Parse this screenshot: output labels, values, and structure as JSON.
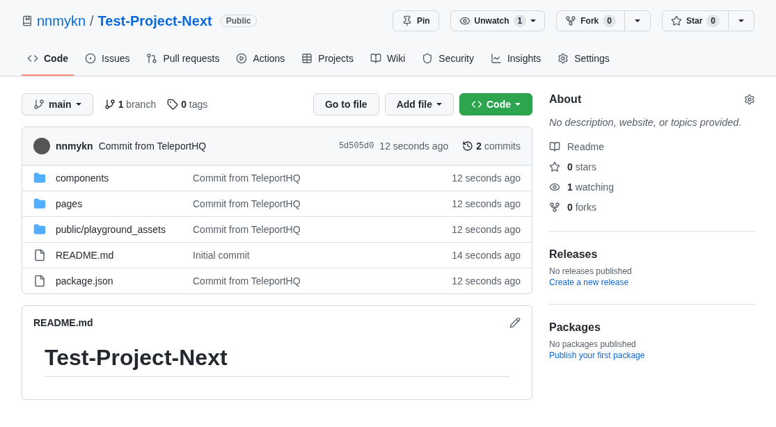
{
  "repo": {
    "owner": "nnmykn",
    "separator": "/",
    "name": "Test-Project-Next",
    "visibility": "Public"
  },
  "actions": [
    {
      "label": "Pin",
      "kind": "plain"
    },
    {
      "label": "Unwatch",
      "count": "1",
      "kind": "caret"
    },
    {
      "label": "Fork",
      "count": "0",
      "kind": "split"
    },
    {
      "label": "Star",
      "count": "0",
      "kind": "split"
    }
  ],
  "tabs": [
    {
      "label": "Code",
      "selected": true
    },
    {
      "label": "Issues",
      "selected": false
    },
    {
      "label": "Pull requests",
      "selected": false
    },
    {
      "label": "Actions",
      "selected": false
    },
    {
      "label": "Projects",
      "selected": false
    },
    {
      "label": "Wiki",
      "selected": false
    },
    {
      "label": "Security",
      "selected": false
    },
    {
      "label": "Insights",
      "selected": false
    },
    {
      "label": "Settings",
      "selected": false
    }
  ],
  "toolbar": {
    "branch": "main",
    "branches": "**1** branch",
    "tags": "**0** tags",
    "buttons": [
      {
        "label": "Go to file",
        "kind": "plain"
      },
      {
        "label": "Add file",
        "kind": "menu"
      },
      {
        "label": "Code",
        "kind": "primary"
      }
    ]
  },
  "commit": {
    "author": "nnmykn",
    "message": "Commit from TeleportHQ",
    "sha": "5d505d0",
    "time": "12 seconds ago",
    "commits": "**2** commits"
  },
  "files": [
    {
      "name": "components",
      "kind": "folder",
      "message": "Commit from TeleportHQ",
      "time": "12 seconds ago"
    },
    {
      "name": "pages",
      "kind": "folder",
      "message": "Commit from TeleportHQ",
      "time": "12 seconds ago"
    },
    {
      "name": "public/playground_assets",
      "kind": "folder",
      "message": "Commit from TeleportHQ",
      "time": "12 seconds ago"
    },
    {
      "name": "README.md",
      "kind": "file",
      "message": "Initial commit",
      "time": "14 seconds ago"
    },
    {
      "name": "package.json",
      "kind": "file",
      "message": "Commit from TeleportHQ",
      "time": "12 seconds ago"
    }
  ],
  "readme": {
    "filename": "README.md",
    "heading": "Test-Project-Next"
  },
  "about": {
    "title": "About",
    "description": "No description, website, or topics provided.",
    "items": [
      "Readme",
      "**0** stars",
      "**1** watching",
      "**0** forks"
    ]
  },
  "releases": {
    "title": "Releases",
    "note": "No releases published",
    "link": "Create a new release"
  },
  "packages": {
    "title": "Packages",
    "note": "No packages published",
    "link": "Publish your first package"
  }
}
